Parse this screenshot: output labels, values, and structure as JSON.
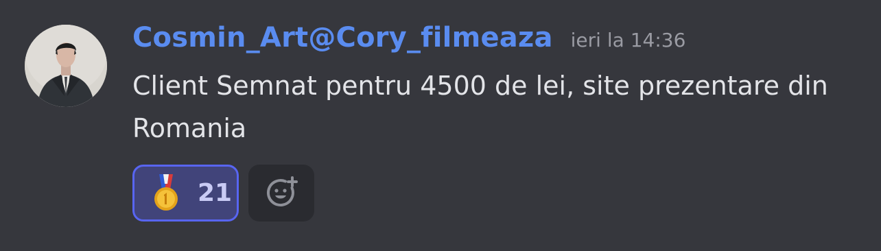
{
  "message": {
    "author": "Cosmin_Art@Cory_filmeaza",
    "timestamp": "ieri la 14:36",
    "content": "Client Semnat pentru 4500 de lei, site prezentare din Romania"
  },
  "reactions": [
    {
      "emoji": "1st-place-medal-icon",
      "count": "21",
      "active": true
    }
  ],
  "colors": {
    "background": "#36373d",
    "username": "#5a8cf0",
    "timestamp": "#9a9ba3",
    "text": "#e3e4e8",
    "reaction_border": "#5865f2",
    "reaction_bg": "#41447a"
  },
  "icons": {
    "add_reaction": "add-reaction-icon"
  }
}
